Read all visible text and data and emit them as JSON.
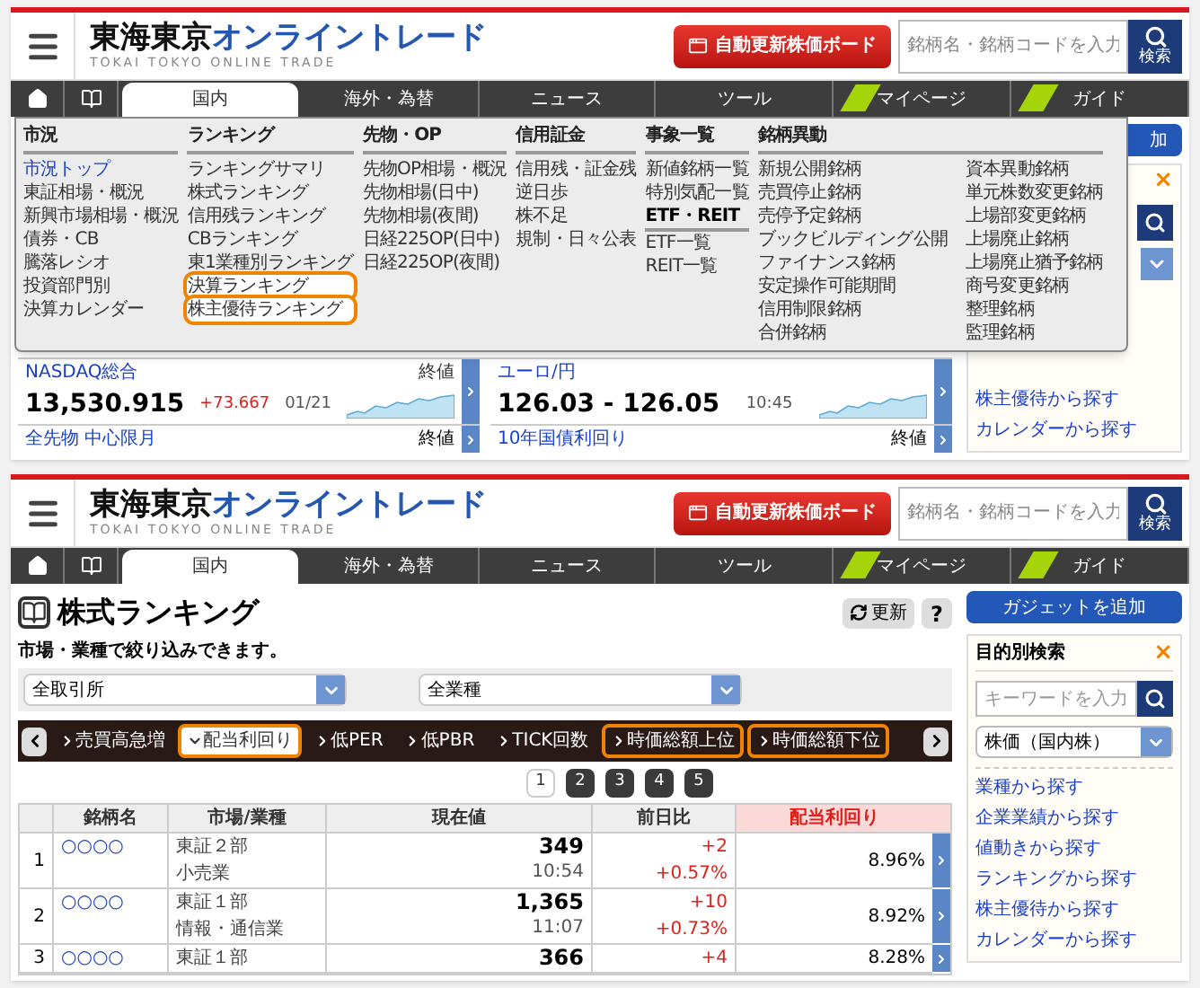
{
  "top_screen": {
    "header": {
      "logo_main": "東海東京",
      "logo_accent": "オンライントレード",
      "logo_sub": "TOKAI TOKYO ONLINE TRADE",
      "board_button": "自動更新株価ボード",
      "search_placeholder": "銘柄名・銘柄コードを入力",
      "search_button": "検索"
    },
    "nav": [
      {
        "label": "国内",
        "selected": true,
        "new": false
      },
      {
        "label": "海外・為替",
        "selected": false,
        "new": false
      },
      {
        "label": "ニュース",
        "selected": false,
        "new": false
      },
      {
        "label": "ツール",
        "selected": false,
        "new": false
      },
      {
        "label": "マイページ",
        "selected": false,
        "new": true
      },
      {
        "label": "ガイド",
        "selected": false,
        "new": true
      }
    ],
    "menu": [
      {
        "heading": "市況",
        "lists": [
          [
            {
              "kind": "link",
              "label": "市況トップ",
              "selected": true,
              "highlighted": false
            },
            {
              "kind": "link",
              "label": "東証相場・概況",
              "selected": false,
              "highlighted": false
            },
            {
              "kind": "link",
              "label": "新興市場相場・概況",
              "selected": false,
              "highlighted": false
            },
            {
              "kind": "link",
              "label": "債券・CB",
              "selected": false,
              "highlighted": false
            },
            {
              "kind": "link",
              "label": "騰落レシオ",
              "selected": false,
              "highlighted": false
            },
            {
              "kind": "link",
              "label": "投資部門別",
              "selected": false,
              "highlighted": false
            },
            {
              "kind": "link",
              "label": "決算カレンダー",
              "selected": false,
              "highlighted": false
            }
          ]
        ]
      },
      {
        "heading": "ランキング",
        "lists": [
          [
            {
              "kind": "link",
              "label": "ランキングサマリ",
              "selected": false,
              "highlighted": false
            },
            {
              "kind": "link",
              "label": "株式ランキング",
              "selected": false,
              "highlighted": false
            },
            {
              "kind": "link",
              "label": "信用残ランキング",
              "selected": false,
              "highlighted": false
            },
            {
              "kind": "link",
              "label": "CBランキング",
              "selected": false,
              "highlighted": false
            },
            {
              "kind": "link",
              "label": "東1業種別ランキング",
              "selected": false,
              "highlighted": false
            },
            {
              "kind": "link",
              "label": "決算ランキング",
              "selected": false,
              "highlighted": true
            },
            {
              "kind": "link",
              "label": "株主優待ランキング",
              "selected": false,
              "highlighted": true
            }
          ]
        ]
      },
      {
        "heading": "先物・OP",
        "lists": [
          [
            {
              "kind": "link",
              "label": "先物OP相場・概況",
              "selected": false,
              "highlighted": false
            },
            {
              "kind": "link",
              "label": "先物相場(日中)",
              "selected": false,
              "highlighted": false
            },
            {
              "kind": "link",
              "label": "先物相場(夜間)",
              "selected": false,
              "highlighted": false
            },
            {
              "kind": "link",
              "label": "日経225OP(日中)",
              "selected": false,
              "highlighted": false
            },
            {
              "kind": "link",
              "label": "日経225OP(夜間)",
              "selected": false,
              "highlighted": false
            }
          ]
        ]
      },
      {
        "heading": "信用証金",
        "lists": [
          [
            {
              "kind": "link",
              "label": "信用残・証金残",
              "selected": false,
              "highlighted": false
            },
            {
              "kind": "link",
              "label": "逆日歩",
              "selected": false,
              "highlighted": false
            },
            {
              "kind": "link",
              "label": "株不足",
              "selected": false,
              "highlighted": false
            },
            {
              "kind": "link",
              "label": "規制・日々公表",
              "selected": false,
              "highlighted": false
            }
          ]
        ]
      },
      {
        "heading": "事象一覧",
        "lists": [
          [
            {
              "kind": "link",
              "label": "新値銘柄一覧",
              "selected": false,
              "highlighted": false
            },
            {
              "kind": "link",
              "label": "特別気配一覧",
              "selected": false,
              "highlighted": false
            },
            {
              "kind": "subheading",
              "label": "ETF・REIT"
            },
            {
              "kind": "link",
              "label": "ETF一覧",
              "selected": false,
              "highlighted": false
            },
            {
              "kind": "link",
              "label": "REIT一覧",
              "selected": false,
              "highlighted": false
            }
          ]
        ]
      },
      {
        "heading": "銘柄異動",
        "lists": [
          [
            {
              "kind": "link",
              "label": "新規公開銘柄",
              "selected": false,
              "highlighted": false
            },
            {
              "kind": "link",
              "label": "売買停止銘柄",
              "selected": false,
              "highlighted": false
            },
            {
              "kind": "link",
              "label": "売停予定銘柄",
              "selected": false,
              "highlighted": false
            },
            {
              "kind": "link",
              "label": "ブックビルディング公開",
              "selected": false,
              "highlighted": false
            },
            {
              "kind": "link",
              "label": "ファイナンス銘柄",
              "selected": false,
              "highlighted": false
            },
            {
              "kind": "link",
              "label": "安定操作可能期間",
              "selected": false,
              "highlighted": false
            },
            {
              "kind": "link",
              "label": "信用制限銘柄",
              "selected": false,
              "highlighted": false
            },
            {
              "kind": "link",
              "label": "合併銘柄",
              "selected": false,
              "highlighted": false
            }
          ],
          [
            {
              "kind": "link",
              "label": "資本異動銘柄",
              "selected": false,
              "highlighted": false
            },
            {
              "kind": "link",
              "label": "単元株数変更銘柄",
              "selected": false,
              "highlighted": false
            },
            {
              "kind": "link",
              "label": "上場部変更銘柄",
              "selected": false,
              "highlighted": false
            },
            {
              "kind": "link",
              "label": "上場廃止銘柄",
              "selected": false,
              "highlighted": false
            },
            {
              "kind": "link",
              "label": "上場廃止猶予銘柄",
              "selected": false,
              "highlighted": false
            },
            {
              "kind": "link",
              "label": "商号変更銘柄",
              "selected": false,
              "highlighted": false
            },
            {
              "kind": "link",
              "label": "整理銘柄",
              "selected": false,
              "highlighted": false
            },
            {
              "kind": "link",
              "label": "監理銘柄",
              "selected": false,
              "highlighted": false
            }
          ]
        ]
      }
    ],
    "markets": [
      {
        "name": "NASDAQ総合",
        "label": "終値",
        "value": "13,530.915",
        "change": "+73.667",
        "time": "01/21"
      },
      {
        "name": "ユーロ/円",
        "value": "126.03 - 126.05",
        "time": "10:45"
      },
      {
        "name": "全先物 中心限月",
        "label": "終値"
      },
      {
        "name": "10年国債利回り",
        "label": "終値"
      }
    ],
    "sidebar": {
      "gadget_button": "加",
      "close": "×",
      "links": [
        "株主優待から探す",
        "カレンダーから探す"
      ]
    }
  },
  "bottom_screen": {
    "header": {
      "logo_main": "東海東京",
      "logo_accent": "オンライントレード",
      "logo_sub": "TOKAI TOKYO ONLINE TRADE",
      "board_button": "自動更新株価ボード",
      "search_placeholder": "銘柄名・銘柄コードを入力",
      "search_button": "検索"
    },
    "nav": [
      {
        "label": "国内",
        "selected": true,
        "new": false
      },
      {
        "label": "海外・為替",
        "selected": false,
        "new": false
      },
      {
        "label": "ニュース",
        "selected": false,
        "new": false
      },
      {
        "label": "ツール",
        "selected": false,
        "new": false
      },
      {
        "label": "マイページ",
        "selected": false,
        "new": true
      },
      {
        "label": "ガイド",
        "selected": false,
        "new": true
      }
    ],
    "title": "株式ランキング",
    "refresh_button": "更新",
    "help_button": "?",
    "filter_note": "市場・業種で絞り込みできます。",
    "selects": [
      "全取引所",
      "全業種"
    ],
    "ranking_tabs": [
      {
        "label": "売買高急増",
        "selected": false,
        "highlighted": false
      },
      {
        "label": "配当利回り",
        "selected": true,
        "highlighted": true
      },
      {
        "label": "低PER",
        "selected": false,
        "highlighted": false
      },
      {
        "label": "低PBR",
        "selected": false,
        "highlighted": false
      },
      {
        "label": "TICK回数",
        "selected": false,
        "highlighted": false
      },
      {
        "label": "時価総額上位",
        "selected": false,
        "highlighted": true
      },
      {
        "label": "時価総額下位",
        "selected": false,
        "highlighted": true
      }
    ],
    "pages": [
      {
        "label": "1",
        "selected": true
      },
      {
        "label": "2",
        "selected": false
      },
      {
        "label": "3",
        "selected": false
      },
      {
        "label": "4",
        "selected": false
      },
      {
        "label": "5",
        "selected": false
      }
    ],
    "table": {
      "columns": [
        "銘柄名",
        "市場/業種",
        "現在値",
        "前日比",
        "配当利回り"
      ],
      "rows": [
        {
          "rank": "1",
          "name": "○○○○",
          "market": "東証２部",
          "sector": "小売業",
          "price": "349",
          "time": "10:54",
          "change": "+2",
          "change_pct": "+0.57%",
          "yield": "8.96%"
        },
        {
          "rank": "2",
          "name": "○○○○",
          "market": "東証１部",
          "sector": "情報・通信業",
          "price": "1,365",
          "time": "11:07",
          "change": "+10",
          "change_pct": "+0.73%",
          "yield": "8.92%"
        },
        {
          "rank": "3",
          "name": "○○○○",
          "market": "東証１部",
          "price": "366",
          "change": "+4",
          "yield": "8.28%"
        }
      ]
    },
    "sidebar": {
      "gadget_button": "ガジェットを追加",
      "title": "目的別検索",
      "close": "×",
      "keyword_placeholder": "キーワードを入力",
      "select": "株価（国内株）",
      "links": [
        "業種から探す",
        "企業業績から探す",
        "値動きから探す",
        "ランキングから探す",
        "株主優待から探す",
        "カレンダーから探す"
      ]
    }
  }
}
